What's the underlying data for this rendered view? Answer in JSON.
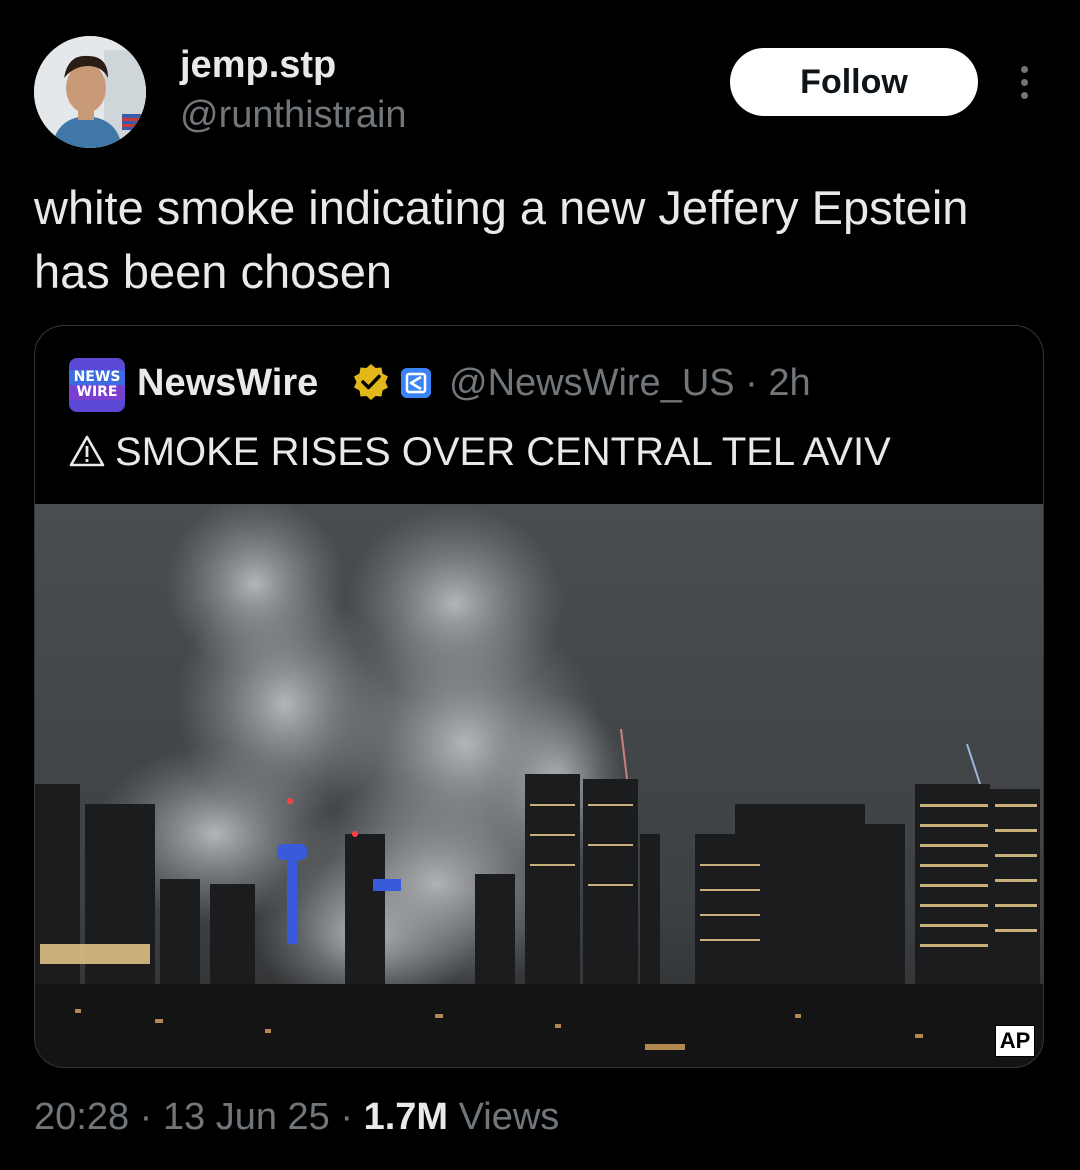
{
  "author": {
    "display_name": "jemp.stp",
    "handle": "@runthistrain",
    "avatar_icon": "avatar-photo"
  },
  "actions": {
    "follow_label": "Follow",
    "more_icon": "more-dots-icon"
  },
  "tweet": {
    "text": "white smoke indicating a new Jeffery Epstein has been chosen"
  },
  "quoted": {
    "logo_line1": "NEWS",
    "logo_line2": "WIRE",
    "display_name": "NewsWire",
    "handle_time": "@NewsWire_US · 2h",
    "text": "SMOKE RISES OVER CENTRAL TEL AVIV",
    "media_watermark": "AP"
  },
  "meta": {
    "time_date": "20:28 · 13 Jun 25 · ",
    "views_count": "1.7M",
    "views_label": " Views"
  },
  "colors": {
    "background": "#000000",
    "text": "#e7e9ea",
    "secondary": "#71767b",
    "border": "#333639",
    "verified_gold": "#e2b719",
    "affiliate_blue": "#3b82f6"
  }
}
